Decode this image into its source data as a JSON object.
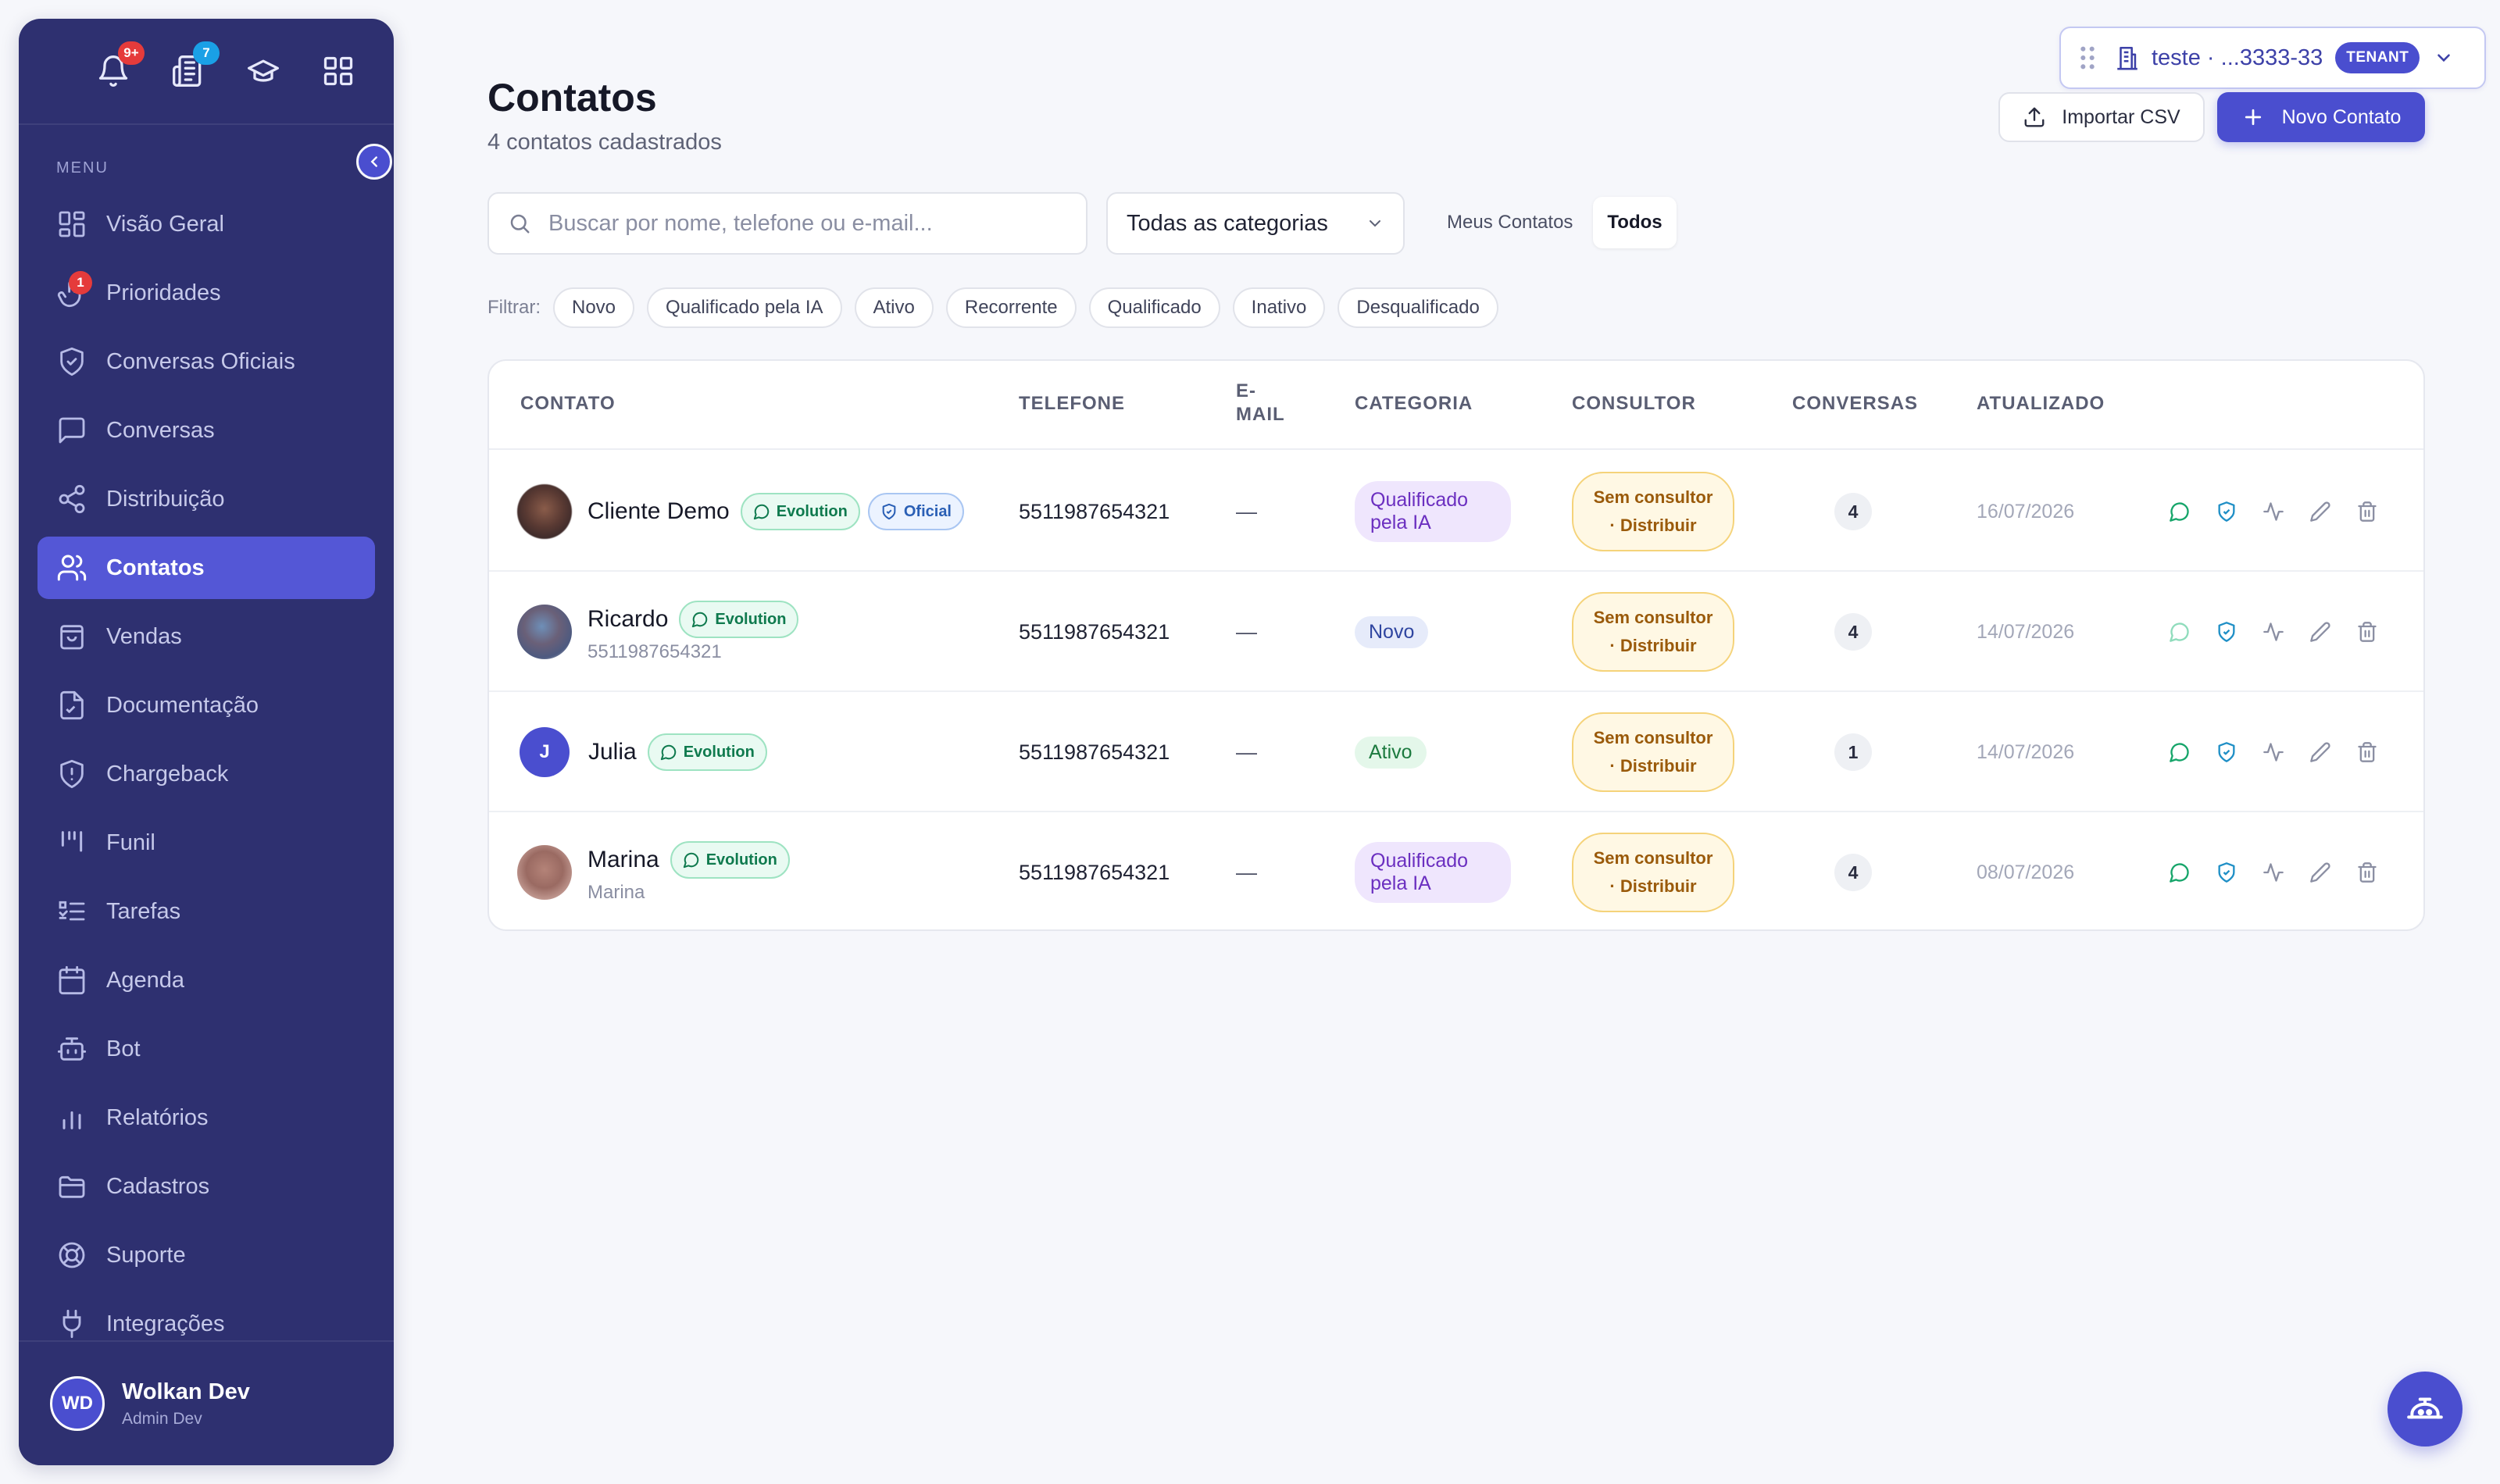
{
  "sidebar": {
    "top_badges": {
      "notifications": "9+",
      "documents": "7"
    },
    "menu_label": "MENU",
    "items": [
      {
        "label": "Visão Geral",
        "icon": "grid-icon"
      },
      {
        "label": "Prioridades",
        "icon": "hand-icon",
        "badge": "1"
      },
      {
        "label": "Conversas Oficiais",
        "icon": "shield-check-icon"
      },
      {
        "label": "Conversas",
        "icon": "chat-icon"
      },
      {
        "label": "Distribuição",
        "icon": "share-icon"
      },
      {
        "label": "Contatos",
        "icon": "users-icon",
        "active": true
      },
      {
        "label": "Vendas",
        "icon": "bag-icon"
      },
      {
        "label": "Documentação",
        "icon": "file-icon"
      },
      {
        "label": "Chargeback",
        "icon": "shield-alert-icon"
      },
      {
        "label": "Funil",
        "icon": "funnel-icon"
      },
      {
        "label": "Tarefas",
        "icon": "list-check-icon"
      },
      {
        "label": "Agenda",
        "icon": "calendar-icon"
      },
      {
        "label": "Bot",
        "icon": "bot-icon"
      },
      {
        "label": "Relatórios",
        "icon": "bar-chart-icon"
      },
      {
        "label": "Cadastros",
        "icon": "folder-icon"
      },
      {
        "label": "Suporte",
        "icon": "lifebuoy-icon"
      },
      {
        "label": "Integrações",
        "icon": "plug-icon"
      }
    ],
    "user": {
      "initials": "WD",
      "name": "Wolkan Dev",
      "role": "Admin Dev"
    }
  },
  "header": {
    "title": "Contatos",
    "subtitle": "4 contatos cadastrados",
    "tenant": {
      "label": "teste · ...3333-33",
      "badge": "TENANT"
    },
    "import_label": "Importar CSV",
    "new_label": "Novo Contato"
  },
  "toolbar": {
    "search_placeholder": "Buscar por nome, telefone ou e-mail...",
    "category_select": "Todas as categorias",
    "toggle": [
      "Meus Contatos",
      "Todos"
    ],
    "filter_label": "Filtrar:",
    "filters": [
      "Novo",
      "Qualificado pela IA",
      "Ativo",
      "Recorrente",
      "Qualificado",
      "Inativo",
      "Desqualificado"
    ]
  },
  "table": {
    "columns": [
      "CONTATO",
      "TELEFONE",
      "E-\nMAIL",
      "CATEGORIA",
      "CONSULTOR",
      "CONVERSAS",
      "ATUALIZADO"
    ],
    "consultant_line1": "Sem consultor",
    "consultant_line2": "· Distribuir",
    "tags": {
      "evolution": "Evolution",
      "oficial": "Oficial"
    },
    "rows": [
      {
        "name": "Cliente Demo",
        "sub": "",
        "phone": "5511987654321",
        "email": "—",
        "category": "Qualificado pela IA",
        "conversations": "4",
        "updated": "16/07/2026"
      },
      {
        "name": "Ricardo",
        "sub": "5511987654321",
        "phone": "5511987654321",
        "email": "—",
        "category": "Novo",
        "conversations": "4",
        "updated": "14/07/2026"
      },
      {
        "name": "Julia",
        "initial": "J",
        "sub": "",
        "phone": "5511987654321",
        "email": "—",
        "category": "Ativo",
        "conversations": "1",
        "updated": "14/07/2026"
      },
      {
        "name": "Marina",
        "sub": "Marina",
        "phone": "5511987654321",
        "email": "—",
        "category": "Qualificado pela IA",
        "conversations": "4",
        "updated": "08/07/2026"
      }
    ]
  },
  "colors": {
    "sidebar": "#2e3070",
    "accent": "#4a4ecf",
    "evolution": "#16a56a",
    "consultant": "#f5d37a"
  }
}
